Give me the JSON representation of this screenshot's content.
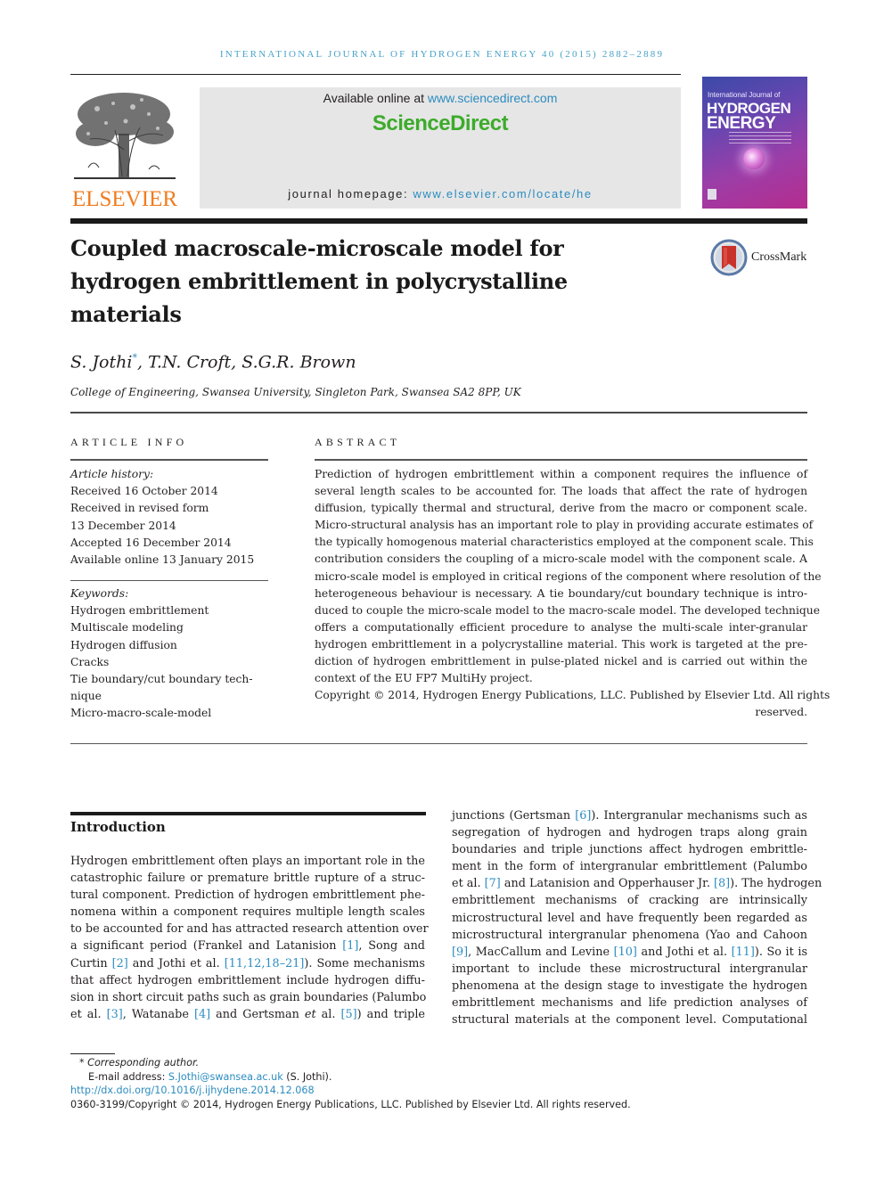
{
  "header": {
    "running_head": "INTERNATIONAL JOURNAL OF HYDROGEN ENERGY 40 (2015) 2882–2889",
    "publisher_logo_text": "ELSEVIER",
    "available_prefix": "Available online at ",
    "available_link": "www.sciencedirect.com",
    "brand": "ScienceDirect",
    "homepage_prefix": "journal homepage: ",
    "homepage_link": "www.elsevier.com/locate/he",
    "cover": {
      "line1": "International Journal of",
      "line2": "HYDROGEN",
      "line3": "ENERGY"
    }
  },
  "article": {
    "title": "Coupled macroscale-microscale model for hydrogen embrittlement in polycrystalline materials",
    "crossmark_label": "CrossMark",
    "authors": [
      {
        "name": "S. Jothi",
        "mark": "*"
      },
      {
        "name": "T.N. Croft",
        "mark": ""
      },
      {
        "name": "S.G.R. Brown",
        "mark": ""
      }
    ],
    "affiliation": "College of Engineering, Swansea University, Singleton Park, Swansea SA2 8PP, UK"
  },
  "article_info": {
    "label": "ARTICLE INFO",
    "history_label": "Article history:",
    "history": [
      "Received 16 October 2014",
      "Received in revised form",
      "13 December 2014",
      "Accepted 16 December 2014",
      "Available online 13 January 2015"
    ],
    "keywords_label": "Keywords:",
    "keywords": [
      "Hydrogen embrittlement",
      "Multiscale modeling",
      "Hydrogen diffusion",
      "Cracks",
      "Tie boundary/cut boundary tech-",
      "nique",
      "Micro-macro-scale-model"
    ]
  },
  "abstract": {
    "label": "ABSTRACT",
    "lines": [
      "Prediction of hydrogen embrittlement within a component requires the influence of",
      "several length scales to be accounted for. The loads that affect the rate of hydrogen",
      "diffusion, typically thermal and structural, derive from the macro or component scale.",
      "Micro-structural analysis has an important role to play in providing accurate estimates of",
      "the typically homogenous material characteristics employed at the component scale. This",
      "contribution considers the coupling of a micro-scale model with the component scale. A",
      "micro-scale model is employed in critical regions of the component where resolution of the",
      "heterogeneous behaviour is necessary. A tie boundary/cut boundary technique is intro-",
      "duced to couple the micro-scale model to the macro-scale model. The developed technique",
      "offers a computationally efficient procedure to analyse the multi-scale inter-granular",
      "hydrogen embrittlement in a polycrystalline material. This work is targeted at the pre-",
      "diction of hydrogen embrittlement in pulse-plated nickel and is carried out within the",
      "context of the EU FP7 MultiHy project."
    ],
    "copyright_line1": "Copyright © 2014, Hydrogen Energy Publications, LLC. Published by Elsevier Ltd. All rights",
    "copyright_line2": "reserved."
  },
  "introduction": {
    "heading": "Introduction",
    "left_lines": [
      [
        {
          "t": "Hydrogen embrittlement often plays an important role in the"
        }
      ],
      [
        {
          "t": "catastrophic failure or premature brittle rupture of a struc-"
        }
      ],
      [
        {
          "t": "tural component. Prediction of hydrogen embrittlement phe-"
        }
      ],
      [
        {
          "t": "nomena within a component requires multiple length scales"
        }
      ],
      [
        {
          "t": "to be accounted for and has attracted research attention over"
        }
      ],
      [
        {
          "t": "a significant period (Frankel and Latanision "
        },
        {
          "t": "[1]",
          "ref": true
        },
        {
          "t": ", Song and"
        }
      ],
      [
        {
          "t": "Curtin "
        },
        {
          "t": "[2]",
          "ref": true
        },
        {
          "t": " and Jothi et al. "
        },
        {
          "t": "[11,12,18–21]",
          "ref": true
        },
        {
          "t": "). Some mechanisms"
        }
      ],
      [
        {
          "t": "that affect hydrogen embrittlement include hydrogen diffu-"
        }
      ],
      [
        {
          "t": "sion in short circuit paths such as grain boundaries (Palumbo"
        }
      ],
      [
        {
          "t": "et al. "
        },
        {
          "t": "[3]",
          "ref": true
        },
        {
          "t": ", Watanabe "
        },
        {
          "t": "[4]",
          "ref": true
        },
        {
          "t": " and Gertsman "
        },
        {
          "t": "et",
          "it": true
        },
        {
          "t": " al. "
        },
        {
          "t": "[5]",
          "ref": true
        },
        {
          "t": ") and triple"
        }
      ]
    ],
    "right_lines": [
      [
        {
          "t": "junctions (Gertsman "
        },
        {
          "t": "[6]",
          "ref": true
        },
        {
          "t": "). Intergranular mechanisms such as"
        }
      ],
      [
        {
          "t": "segregation of hydrogen and hydrogen traps along grain"
        }
      ],
      [
        {
          "t": "boundaries and triple junctions affect hydrogen embrittle-"
        }
      ],
      [
        {
          "t": "ment in the form of intergranular embrittlement (Palumbo"
        }
      ],
      [
        {
          "t": "et al. "
        },
        {
          "t": "[7]",
          "ref": true
        },
        {
          "t": " and Latanision and Opperhauser Jr. "
        },
        {
          "t": "[8]",
          "ref": true
        },
        {
          "t": "). The hydrogen"
        }
      ],
      [
        {
          "t": "embrittlement mechanisms of cracking are intrinsically"
        }
      ],
      [
        {
          "t": "microstructural level and have frequently been regarded as"
        }
      ],
      [
        {
          "t": "microstructural intergranular phenomena (Yao and Cahoon"
        }
      ],
      [
        {
          "t": "[9]",
          "ref": true
        },
        {
          "t": ", MacCallum and Levine "
        },
        {
          "t": "[10]",
          "ref": true
        },
        {
          "t": " and Jothi et al. "
        },
        {
          "t": "[11]",
          "ref": true
        },
        {
          "t": "). So it is"
        }
      ],
      [
        {
          "t": "important to include these microstructural intergranular"
        }
      ],
      [
        {
          "t": "phenomena at the design stage to investigate the hydrogen"
        }
      ],
      [
        {
          "t": "embrittlement mechanisms and life prediction analyses of"
        }
      ],
      [
        {
          "t": "structural materials at the component level. Computational"
        }
      ]
    ]
  },
  "footnotes": {
    "corresponding": "* Corresponding author.",
    "email_label": "E-mail address: ",
    "email": "S.Jothi@swansea.ac.uk",
    "email_suffix": " (S. Jothi).",
    "doi": "http://dx.doi.org/10.1016/j.ijhydene.2014.12.068",
    "copyright": "0360-3199/Copyright © 2014, Hydrogen Energy Publications, LLC. Published by Elsevier Ltd. All rights reserved."
  },
  "colors": {
    "link": "#2c8cc0",
    "brand_green": "#3dab2b",
    "elsevier_orange": "#f07c1f"
  }
}
